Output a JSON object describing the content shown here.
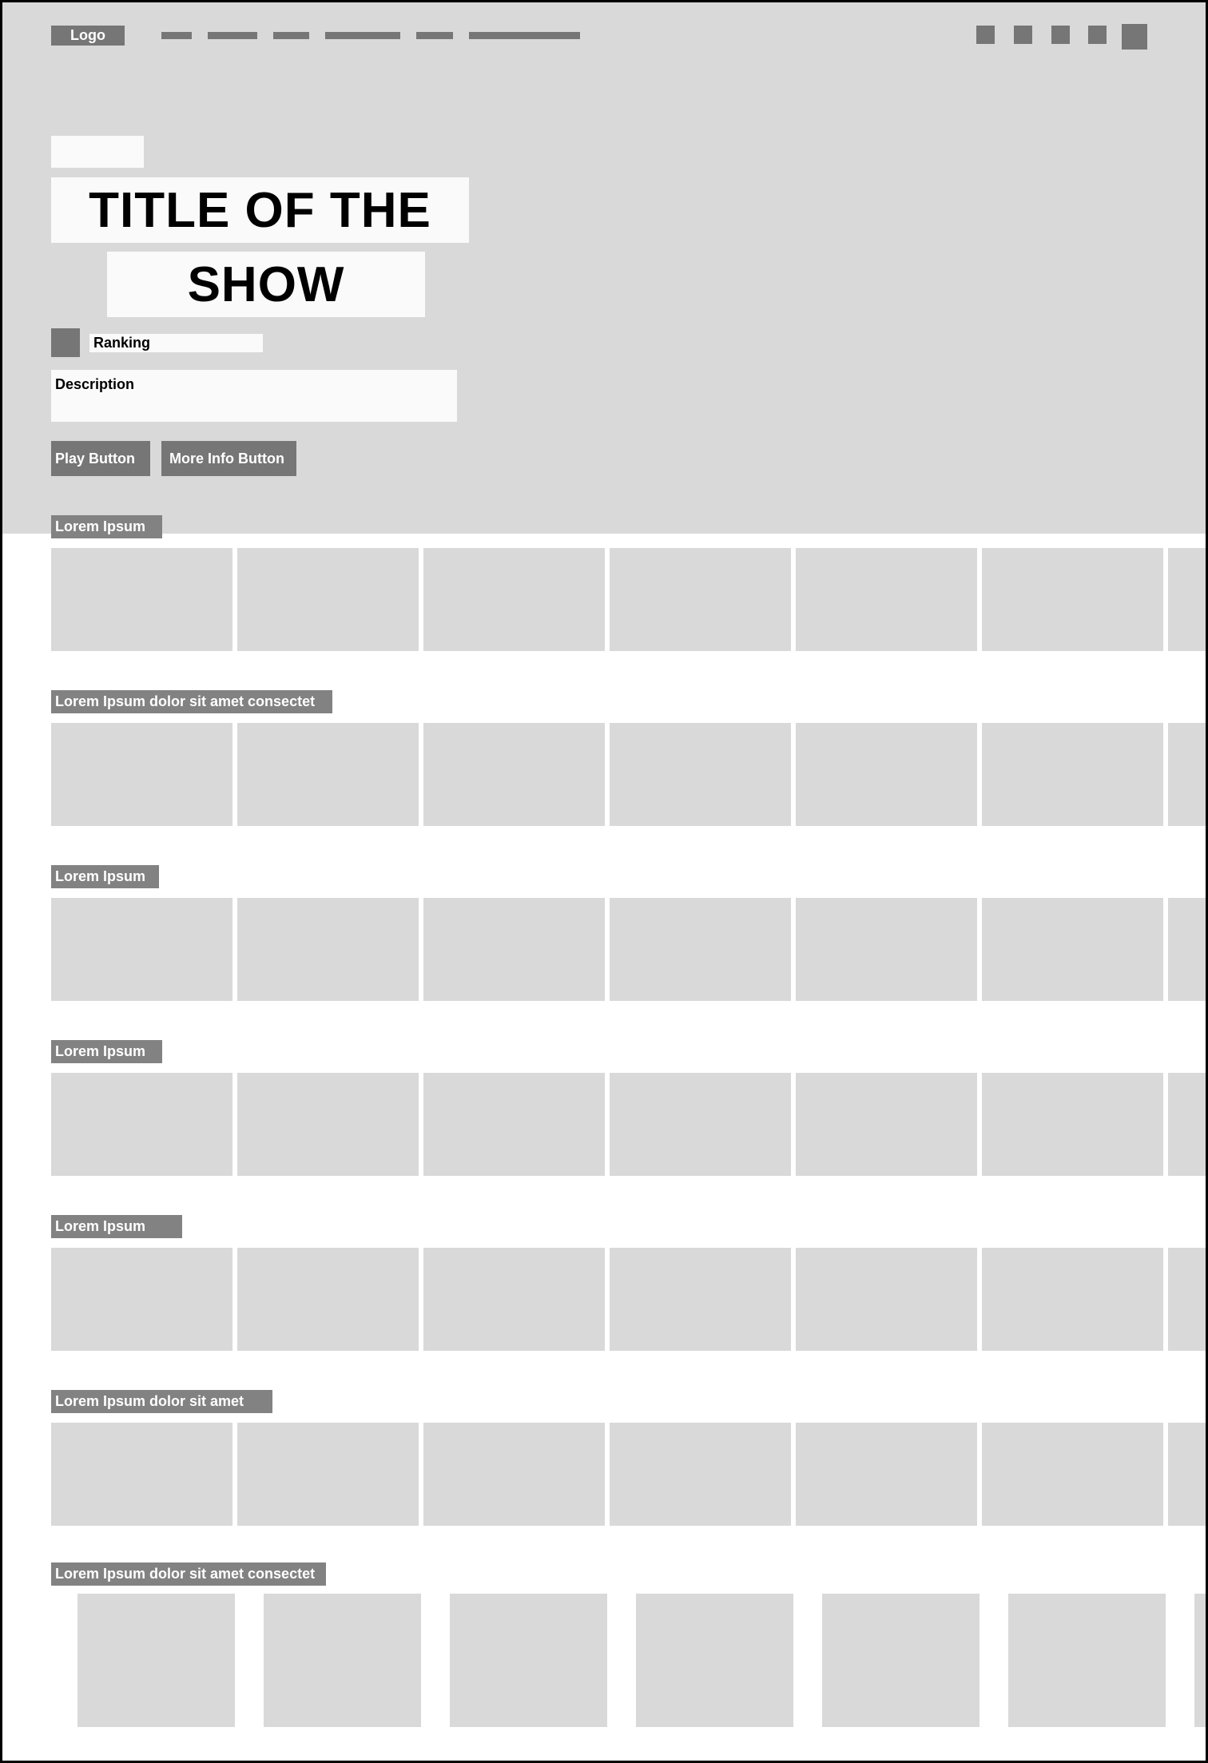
{
  "header": {
    "logo_label": "Logo",
    "nav_links": [
      "",
      "",
      "",
      "",
      "",
      ""
    ],
    "icons": [
      "search-icon",
      "notification-icon",
      "gift-icon",
      "kids-icon",
      "profile-avatar"
    ]
  },
  "hero": {
    "title_line_1": "TITLE OF THE",
    "title_line_2": "SHOW",
    "ranking_label": "Ranking",
    "description_label": "Description",
    "play_button_label": "Play Button",
    "more_info_button_label": "More Info Button"
  },
  "rows": [
    {
      "label": "Lorem Ipsum"
    },
    {
      "label": "Lorem Ipsum dolor sit amet consectet"
    },
    {
      "label": "Lorem Ipsum"
    },
    {
      "label": "Lorem Ipsum"
    },
    {
      "label": "Lorem Ipsum"
    },
    {
      "label": "Lorem Ipsum dolor sit amet"
    },
    {
      "label": "Lorem Ipsum dolor sit amet consectet"
    }
  ],
  "colors": {
    "placeholder_dark": "#767676",
    "label_bg": "#828282",
    "hero_bg": "#d9d9d9",
    "tile_bg": "#d9d9d9"
  }
}
